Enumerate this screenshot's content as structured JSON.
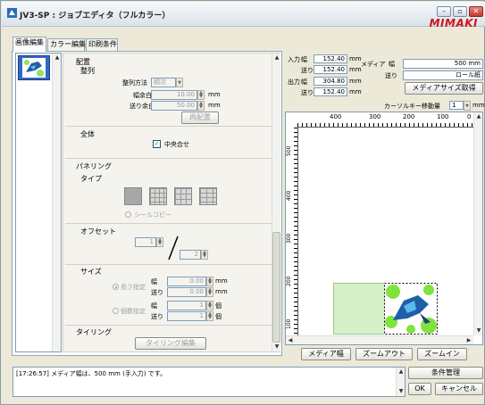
{
  "window": {
    "title": "JV3-SP : ジョブエディタ（フルカラー）",
    "brand": "MIMAKI"
  },
  "tabs": [
    "画像編集",
    "カラー編集",
    "印刷条件"
  ],
  "layout": {
    "heading": "配置",
    "align_label": "整列",
    "align_method_label": "整列方法",
    "align_method_value": "順次",
    "width_margin_label": "幅余白",
    "width_margin_value": "10.00",
    "feed_margin_label": "送り余白",
    "feed_margin_value": "50.00",
    "unit_mm": "mm",
    "rearrange_button": "再配置"
  },
  "overall": {
    "label": "全体",
    "center_label": "中央合せ",
    "center_checked": true
  },
  "paneling": {
    "label": "パネリング",
    "type_label": "タイプ",
    "seal_copy_label": "シールコピー",
    "offset_label": "オフセット",
    "offset_value1": "1",
    "offset_value2": "2",
    "size_label": "サイズ",
    "length_spec_label": "長さ指定",
    "count_spec_label": "個数指定",
    "width_label": "幅",
    "feed_label": "送り",
    "length_width_value": "0.00",
    "length_feed_value": "0.00",
    "count_width_value": "1",
    "count_feed_value": "1",
    "unit_count": "個"
  },
  "tiling": {
    "label": "タイリング",
    "edit_button": "タイリング編集"
  },
  "info": {
    "input_label": "入力",
    "output_label": "出力",
    "width_label": "幅",
    "feed_label": "送り",
    "input_width": "152.40",
    "input_feed": "152.40",
    "output_width": "304.80",
    "output_feed": "152.40",
    "unit_mm": "mm",
    "media_label": "メディア",
    "media_width_label": "幅",
    "media_feed_label": "送り",
    "media_width_value": "500 mm",
    "media_feed_value": "ロール紙",
    "get_media_button": "メディアサイズ取得",
    "cursor_step_label": "カーソルキー移動量",
    "cursor_step_value": "1",
    "cursor_step_unit": "mm"
  },
  "ruler": {
    "top_labels": [
      "400",
      "300",
      "200",
      "100",
      "0"
    ],
    "side_labels": [
      "500",
      "400",
      "300",
      "200",
      "100"
    ]
  },
  "preview_buttons": {
    "media_width": "メディア幅",
    "zoom_out": "ズームアウト",
    "zoom_in": "ズームイン"
  },
  "log": {
    "message": "[17:26:57] メディア幅は、500 mm (手入力) です。"
  },
  "footer_buttons": {
    "condition": "条件管理",
    "ok": "OK",
    "cancel": "キャンセル"
  },
  "colors": {
    "brand_red": "#d7141a",
    "selection_blue": "#316ac5",
    "media_green": "#d6f0c8"
  }
}
